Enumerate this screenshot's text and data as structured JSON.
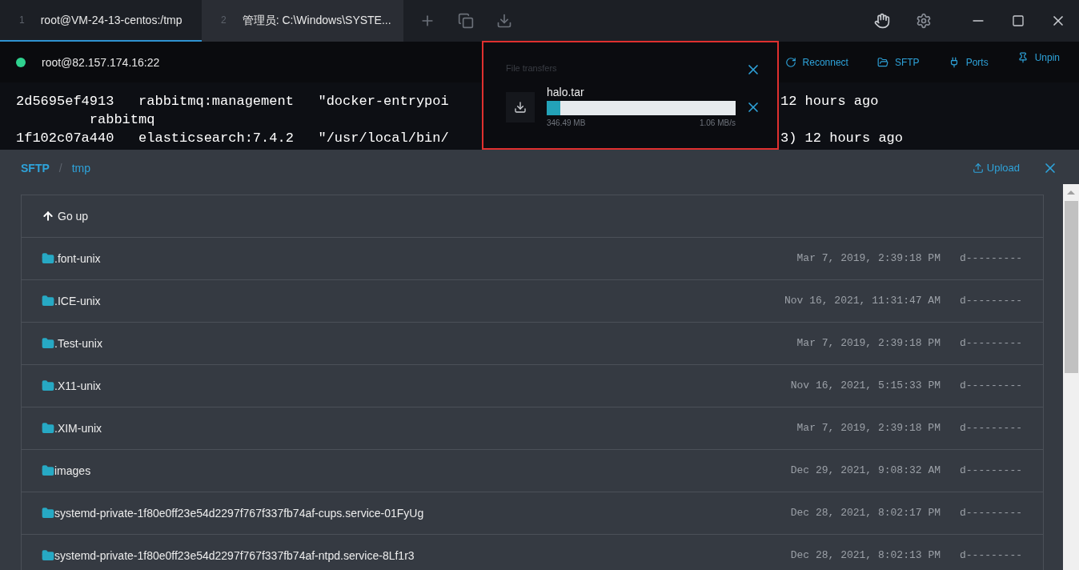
{
  "tabs": [
    {
      "number": "1",
      "title": "root@VM-24-13-centos:/tmp",
      "selected": true
    },
    {
      "number": "2",
      "title": "管理员: C:\\Windows\\SYSTE...",
      "selected": false
    }
  ],
  "session": {
    "host": "root@82.157.174.16:22",
    "connected": true,
    "actions": [
      {
        "kind": "reconnect",
        "label": "Reconnect"
      },
      {
        "kind": "sftp",
        "label": "SFTP"
      },
      {
        "kind": "ports",
        "label": "Ports"
      },
      {
        "kind": "unpin",
        "label": "Unpin"
      }
    ]
  },
  "terminal": {
    "lines": [
      {
        "left": "2d5695ef4913   rabbitmq:management   \"docker-entrypoi",
        "right": "12 hours ago"
      },
      {
        "left": "         rabbitmq"
      },
      {
        "left": "1f102c07a440   elasticsearch:7.4.2   \"/usr/local/bin/",
        "right": "3) 12 hours ago"
      }
    ]
  },
  "file_transfers": {
    "title": "File transfers",
    "items": [
      {
        "name": "halo.tar",
        "level": 0.07,
        "size": "346.49 MB",
        "speed": "1.06 MB/s"
      }
    ]
  },
  "sftp": {
    "breadcrumb": [
      {
        "label": "SFTP",
        "bold": true
      },
      {
        "label": "tmp",
        "bold": false
      }
    ],
    "separator": "/",
    "upload": "Upload",
    "files": [
      {
        "kind": "up",
        "name": "Go up"
      },
      {
        "kind": "folder",
        "name": ".font-unix",
        "date": "Mar 7, 2019, 2:39:18 PM",
        "mode": "d---------"
      },
      {
        "kind": "folder",
        "name": ".ICE-unix",
        "date": "Nov 16, 2021, 11:31:47 AM",
        "mode": "d---------"
      },
      {
        "kind": "folder",
        "name": ".Test-unix",
        "date": "Mar 7, 2019, 2:39:18 PM",
        "mode": "d---------"
      },
      {
        "kind": "folder",
        "name": ".X11-unix",
        "date": "Nov 16, 2021, 5:15:33 PM",
        "mode": "d---------"
      },
      {
        "kind": "folder",
        "name": ".XIM-unix",
        "date": "Mar 7, 2019, 2:39:18 PM",
        "mode": "d---------"
      },
      {
        "kind": "folder",
        "name": "images",
        "date": "Dec 29, 2021, 9:08:32 AM",
        "mode": "d---------"
      },
      {
        "kind": "folder",
        "name": "systemd-private-1f80e0ff23e54d2297f767f337fb74af-cups.service-01FyUg",
        "date": "Dec 28, 2021, 8:02:17 PM",
        "mode": "d---------"
      },
      {
        "kind": "folder",
        "name": "systemd-private-1f80e0ff23e54d2297f767f337fb74af-ntpd.service-8Lf1r3",
        "date": "Dec 28, 2021, 8:02:13 PM",
        "mode": "d---------"
      }
    ]
  }
}
